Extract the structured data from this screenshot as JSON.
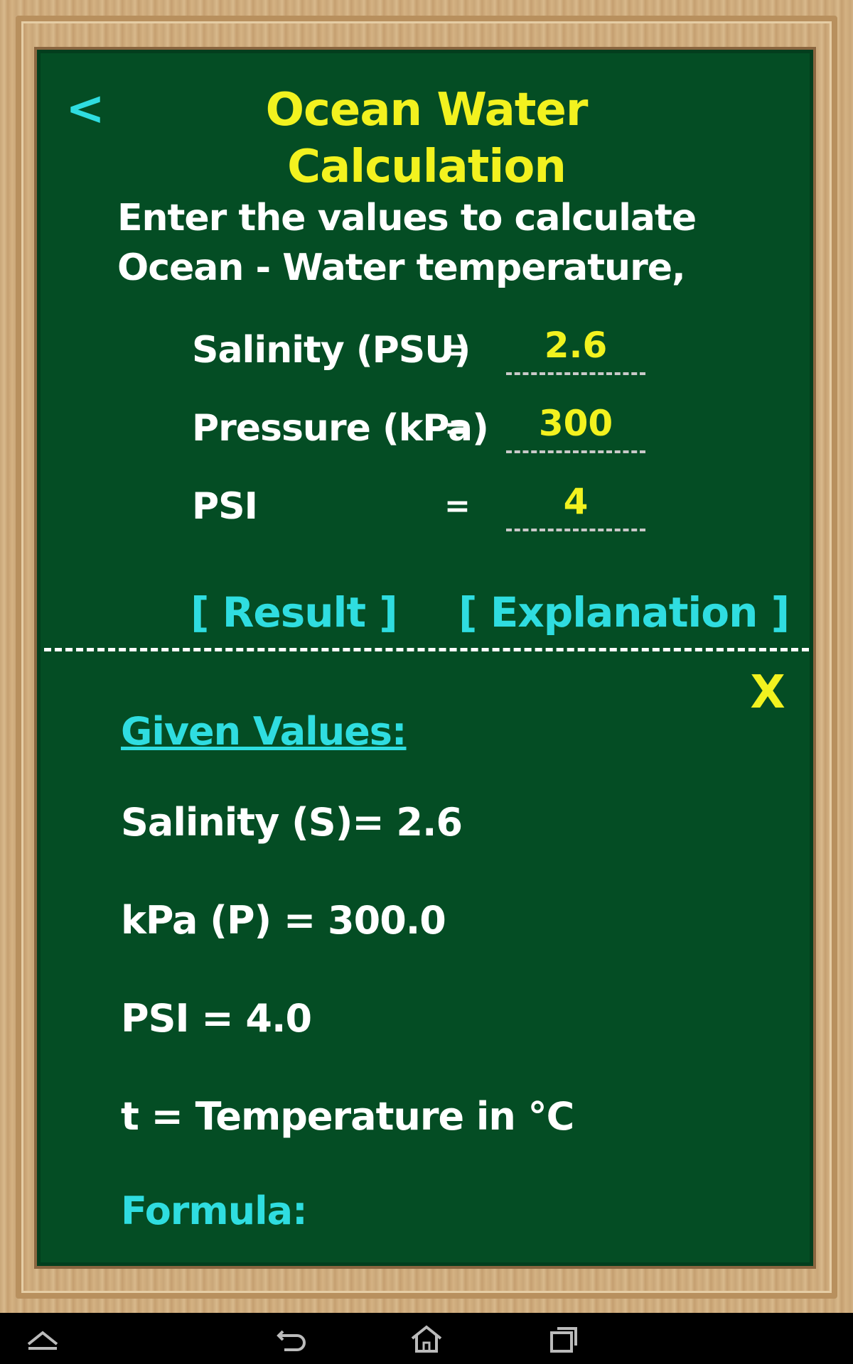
{
  "header": {
    "back_label": "<",
    "title": "Ocean Water Calculation"
  },
  "intro_text": "Enter the values to calculate Ocean - Water temperature,",
  "inputs": [
    {
      "label": "Salinity (PSU)",
      "eq": "=",
      "value": "2.6"
    },
    {
      "label": "Pressure (kPa)",
      "eq": "=",
      "value": "300"
    },
    {
      "label": "PSI",
      "eq": "=",
      "value": "4"
    }
  ],
  "buttons": {
    "result": "[ Result ]",
    "explanation": "[ Explanation ]"
  },
  "result": {
    "close_label": "X",
    "given_title": "Given Values:",
    "lines": [
      "Salinity (S)= 2.6",
      "kPa (P) = 300.0",
      "PSI = 4.0",
      "t = Temperature in °C"
    ],
    "formula_title": "Formula:"
  },
  "navbar": {
    "icons": [
      "up-chevron-icon",
      "back-icon",
      "home-icon",
      "recent-apps-icon"
    ]
  },
  "colors": {
    "board": "#044d24",
    "title": "#f2f21f",
    "accent": "#2fdde0",
    "text": "#ffffff"
  }
}
